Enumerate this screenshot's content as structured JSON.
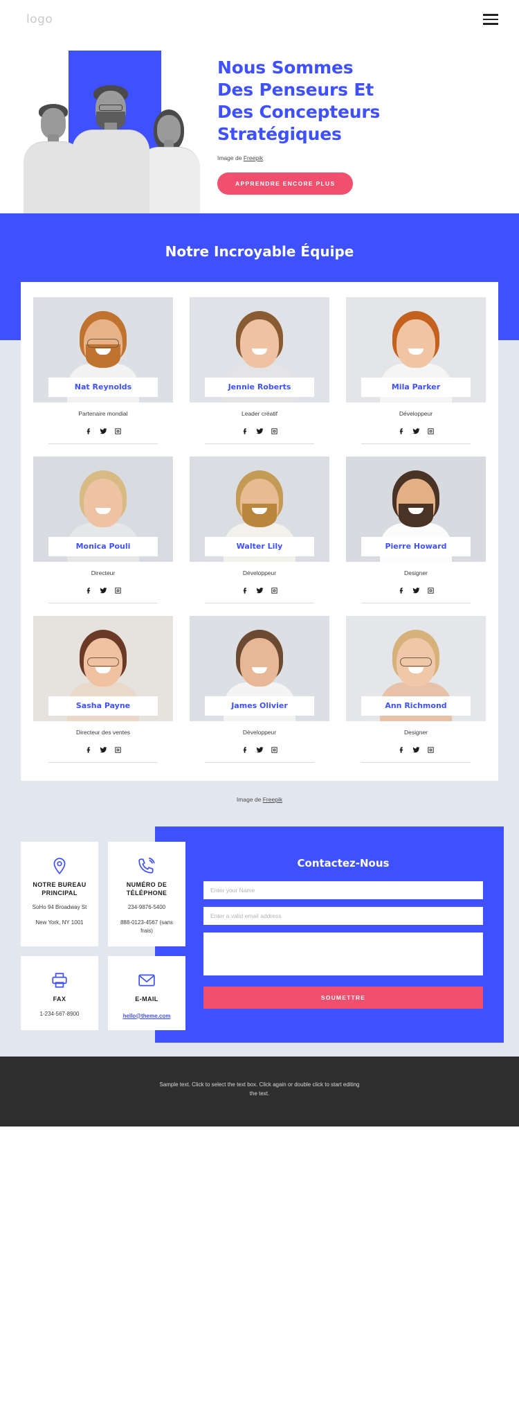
{
  "header": {
    "logo": "logo",
    "menu_icon": "hamburger-menu-icon"
  },
  "hero": {
    "title_lines": [
      "Nous Sommes",
      "Des Penseurs Et",
      "Des Concepteurs",
      "Stratégiques"
    ],
    "title": "Nous Sommes Des Penseurs Et Des Concepteurs Stratégiques",
    "caption_prefix": "Image de ",
    "caption_link": "Freepik",
    "cta_label": "APPRENDRE ENCORE PLUS",
    "accent_color": "#3f51ff",
    "cta_color": "#f0506e"
  },
  "team": {
    "heading": "Notre Incroyable Équipe",
    "caption_prefix": "Image de ",
    "caption_link": "Freepik",
    "social_icons": [
      "facebook-icon",
      "twitter-icon",
      "instagram-icon"
    ],
    "members": [
      {
        "name": "Nat Reynolds",
        "role": "Partenaire mondial"
      },
      {
        "name": "Jennie Roberts",
        "role": "Leader créatif"
      },
      {
        "name": "Mila Parker",
        "role": "Développeur"
      },
      {
        "name": "Monica Pouli",
        "role": "Directeur"
      },
      {
        "name": "Walter Lily",
        "role": "Développeur"
      },
      {
        "name": "Pierre Howard",
        "role": "Designer"
      },
      {
        "name": "Sasha Payne",
        "role": "Directeur des ventes"
      },
      {
        "name": "James Olivier",
        "role": "Développeur"
      },
      {
        "name": "Ann Richmond",
        "role": "Designer"
      }
    ]
  },
  "contact": {
    "cards": [
      {
        "icon": "location-pin-icon",
        "title": "NOTRE BUREAU PRINCIPAL",
        "lines": [
          "SoHo 94 Broadway St",
          "New York, NY 1001"
        ]
      },
      {
        "icon": "phone-icon",
        "title": "NUMÉRO DE TÉLÉPHONE",
        "lines": [
          "234-9876-5400",
          "888-0123-4567 (sans frais)"
        ]
      },
      {
        "icon": "printer-icon",
        "title": "FAX",
        "lines": [
          "1-234-567-8900"
        ]
      },
      {
        "icon": "envelope-icon",
        "title": "E-MAIL",
        "lines": [],
        "link": "hello@theme.com"
      }
    ],
    "form": {
      "title": "Contactez-Nous",
      "name_placeholder": "Enter your Name",
      "email_placeholder": "Enter a valid email address",
      "message_placeholder": "",
      "submit_label": "SOUMETTRE"
    }
  },
  "footer": {
    "text": "Sample text. Click to select the text box. Click again or double click to start editing the text."
  }
}
